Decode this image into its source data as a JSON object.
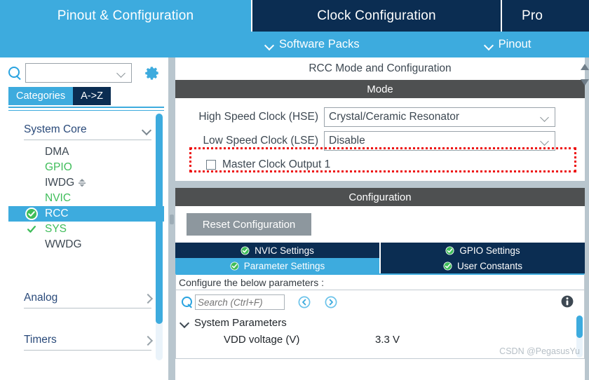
{
  "window": {
    "main_tabs": [
      {
        "label": "Pinout & Configuration",
        "active": true
      },
      {
        "label": "Clock Configuration",
        "active": false
      },
      {
        "label": "Pro",
        "active": false
      }
    ],
    "sub_bar": [
      {
        "label": "Software Packs",
        "icon": "chevron-down-icon"
      },
      {
        "label": "Pinout",
        "icon": "chevron-down-icon"
      }
    ]
  },
  "sidebar": {
    "search": {
      "value": "",
      "placeholder": "",
      "icon": "search-icon"
    },
    "settings_icon": "gear-icon",
    "view_tabs": [
      {
        "label": "Categories",
        "active": true
      },
      {
        "label": "A->Z",
        "active": false
      }
    ],
    "groups": [
      {
        "label": "System Core",
        "expanded": true,
        "items": [
          {
            "label": "DMA",
            "state": "none",
            "selected": false
          },
          {
            "label": "GPIO",
            "state": "configured",
            "selected": false
          },
          {
            "label": "IWDG",
            "state": "none",
            "selected": false
          },
          {
            "label": "NVIC",
            "state": "configured",
            "selected": false
          },
          {
            "label": "RCC",
            "state": "checked",
            "selected": true
          },
          {
            "label": "SYS",
            "state": "checked",
            "selected": false
          },
          {
            "label": "WWDG",
            "state": "none",
            "selected": false
          }
        ]
      },
      {
        "label": "Analog",
        "expanded": false,
        "items": []
      },
      {
        "label": "Timers",
        "expanded": false,
        "items": []
      }
    ]
  },
  "main": {
    "title": "RCC Mode and Configuration",
    "mode": {
      "header": "Mode",
      "rows": [
        {
          "label": "High Speed Clock (HSE)",
          "value": "Crystal/Ceramic Resonator",
          "highlighted": true
        },
        {
          "label": "Low Speed Clock (LSE)",
          "value": "Disable",
          "highlighted": false
        }
      ],
      "checkbox": {
        "label": "Master Clock Output 1",
        "checked": false
      }
    },
    "configuration": {
      "header": "Configuration",
      "reset_button": "Reset Configuration",
      "tabs": [
        {
          "label": "NVIC Settings",
          "active": false,
          "icon": "check-circle-icon"
        },
        {
          "label": "GPIO Settings",
          "active": false,
          "icon": "check-circle-icon"
        },
        {
          "label": "Parameter Settings",
          "active": true,
          "icon": "check-circle-icon"
        },
        {
          "label": "User Constants",
          "active": false,
          "icon": "check-circle-icon"
        }
      ],
      "note": "Configure the below parameters :",
      "toolbar": {
        "search_placeholder": "Search (Ctrl+F)",
        "search_value": "",
        "search_icon": "search-icon",
        "prev_icon": "previous-circle-icon",
        "next_icon": "next-circle-icon",
        "info_icon": "info-icon"
      },
      "parameters": [
        {
          "group": "System Parameters",
          "expanded": true,
          "rows": [
            {
              "name": "VDD voltage (V)",
              "value": "3.3 V"
            }
          ]
        }
      ]
    }
  },
  "watermark": "CSDN @PegasusYu",
  "colors": {
    "accent_light_blue": "#3dabde",
    "navy": "#0b2d52",
    "dark_gray_header": "#4e5051",
    "annotation_red": "#ee1111",
    "green_check": "#3fbd5a",
    "panel_gray": "#b9c6ce"
  }
}
